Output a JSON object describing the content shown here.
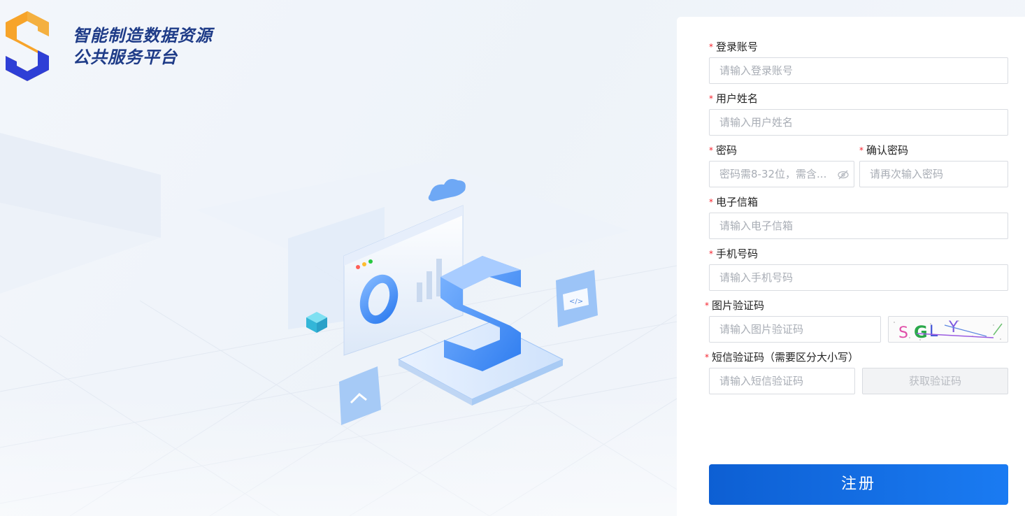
{
  "brand": {
    "line1": "智能制造数据资源",
    "line2": "公共服务平台",
    "logo_icon": "s-hexagon-logo-icon",
    "colors": {
      "orange": "#f7a42a",
      "blue": "#2e3fd6"
    }
  },
  "hero": {
    "illustration": "isometric-data-platform-illustration"
  },
  "form": {
    "fields": {
      "account": {
        "label": "登录账号",
        "placeholder": "请输入登录账号"
      },
      "username": {
        "label": "用户姓名",
        "placeholder": "请输入用户姓名"
      },
      "password": {
        "label": "密码",
        "placeholder": "密码需8-32位，需含..."
      },
      "confirm_password": {
        "label": "确认密码",
        "placeholder": "请再次输入密码"
      },
      "email": {
        "label": "电子信箱",
        "placeholder": "请输入电子信箱"
      },
      "phone": {
        "label": "手机号码",
        "placeholder": "请输入手机号码"
      },
      "image_code": {
        "label": "图片验证码",
        "placeholder": "请输入图片验证码"
      },
      "sms_code": {
        "label": "短信验证码（需要区分大小写）",
        "placeholder": "请输入短信验证码"
      }
    },
    "required_mark": "*",
    "sms_button": "获取验证码",
    "submit": "注册",
    "accent": "#1a6fe6"
  }
}
